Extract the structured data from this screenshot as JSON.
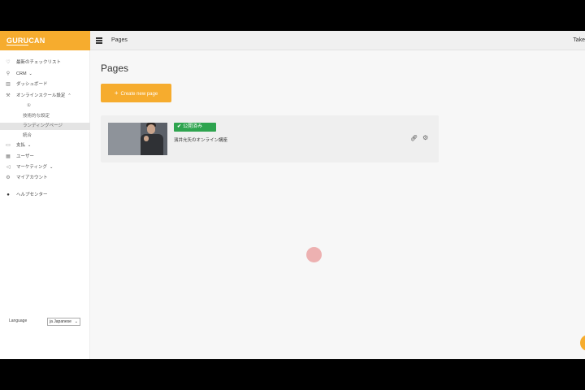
{
  "app": {
    "logo_left": "GURU",
    "logo_right": "CAN",
    "topbar_title": "Pages",
    "user_name": "Take"
  },
  "sidebar": {
    "items": [
      {
        "label": "最新のチェックリスト",
        "icon": "heart-icon"
      },
      {
        "label": "CRM",
        "icon": "gauge-icon",
        "chevron": "down"
      },
      {
        "label": "ダッシュボード",
        "icon": "bar-chart-icon"
      },
      {
        "label": "オンラインスクール設定",
        "icon": "wrench-icon",
        "chevron": "up"
      }
    ],
    "subitems": [
      "①",
      "技術的な設定",
      "ランディングページ",
      "統合"
    ],
    "items2": [
      {
        "label": "支払",
        "icon": "money-icon",
        "chevron": "down"
      },
      {
        "label": "ユーザー",
        "icon": "users-icon"
      },
      {
        "label": "マーケティング",
        "icon": "megaphone-icon",
        "chevron": "down"
      },
      {
        "label": "マイアカウント",
        "icon": "gear-icon"
      },
      {
        "label": "ヘルプセンター",
        "icon": "help-icon"
      }
    ],
    "language_label": "Language",
    "language_value": "ja Japanese"
  },
  "main": {
    "heading": "Pages",
    "create_button": "Create new page",
    "pages": [
      {
        "status": "公開済み",
        "title": "濱井允矢のオンライン講座"
      }
    ]
  },
  "colors": {
    "accent": "#f6ac2e",
    "published": "#2ea44f"
  }
}
